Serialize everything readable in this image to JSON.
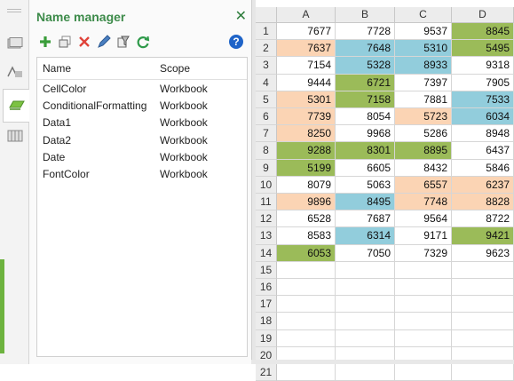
{
  "panel": {
    "title": "Name manager",
    "close_glyph": "✕",
    "toolbar": {
      "add_icon": "plus-icon",
      "edit_icon": "edit-icon",
      "delete_icon": "delete-icon",
      "pencil_icon": "pencil-icon",
      "filter_icon": "filter-icon",
      "refresh_icon": "refresh-icon",
      "help_glyph": "?"
    },
    "columns": [
      "Name",
      "Scope"
    ],
    "rows": [
      {
        "name": "CellColor",
        "scope": "Workbook"
      },
      {
        "name": "ConditionalFormatting",
        "scope": "Workbook"
      },
      {
        "name": "Data1",
        "scope": "Workbook"
      },
      {
        "name": "Data2",
        "scope": "Workbook"
      },
      {
        "name": "Date",
        "scope": "Workbook"
      },
      {
        "name": "FontColor",
        "scope": "Workbook"
      }
    ]
  },
  "colors": {
    "green": "#9bbb59",
    "blue": "#92cddc",
    "peach": "#fbd4b4",
    "white": "#ffffff",
    "accent": "#3d8b4a"
  },
  "sheet": {
    "columns": [
      "A",
      "B",
      "C",
      "D"
    ],
    "row_numbers": [
      "1",
      "2",
      "3",
      "4",
      "5",
      "6",
      "7",
      "8",
      "9",
      "10",
      "11",
      "12",
      "13",
      "14",
      "15",
      "16",
      "17",
      "18",
      "19",
      "20",
      "21"
    ],
    "cells": [
      [
        [
          "7677",
          "white"
        ],
        [
          "7728",
          "white"
        ],
        [
          "9537",
          "white"
        ],
        [
          "8845",
          "green"
        ]
      ],
      [
        [
          "7637",
          "peach"
        ],
        [
          "7648",
          "blue"
        ],
        [
          "5310",
          "blue"
        ],
        [
          "5495",
          "green"
        ]
      ],
      [
        [
          "7154",
          "white"
        ],
        [
          "5328",
          "blue"
        ],
        [
          "8933",
          "blue"
        ],
        [
          "9318",
          "white"
        ]
      ],
      [
        [
          "9444",
          "white"
        ],
        [
          "6721",
          "green"
        ],
        [
          "7397",
          "white"
        ],
        [
          "7905",
          "white"
        ]
      ],
      [
        [
          "5301",
          "peach"
        ],
        [
          "7158",
          "green"
        ],
        [
          "7881",
          "white"
        ],
        [
          "7533",
          "blue"
        ]
      ],
      [
        [
          "7739",
          "peach"
        ],
        [
          "8054",
          "white"
        ],
        [
          "5723",
          "peach"
        ],
        [
          "6034",
          "blue"
        ]
      ],
      [
        [
          "8250",
          "peach"
        ],
        [
          "9968",
          "white"
        ],
        [
          "5286",
          "white"
        ],
        [
          "8948",
          "white"
        ]
      ],
      [
        [
          "9288",
          "green"
        ],
        [
          "8301",
          "green"
        ],
        [
          "8895",
          "green"
        ],
        [
          "6437",
          "white"
        ]
      ],
      [
        [
          "5199",
          "green"
        ],
        [
          "6605",
          "white"
        ],
        [
          "8432",
          "white"
        ],
        [
          "5846",
          "white"
        ]
      ],
      [
        [
          "8079",
          "white"
        ],
        [
          "5063",
          "white"
        ],
        [
          "6557",
          "peach"
        ],
        [
          "6237",
          "peach"
        ]
      ],
      [
        [
          "9896",
          "peach"
        ],
        [
          "8495",
          "blue"
        ],
        [
          "7748",
          "peach"
        ],
        [
          "8828",
          "peach"
        ]
      ],
      [
        [
          "6528",
          "white"
        ],
        [
          "7687",
          "white"
        ],
        [
          "9564",
          "white"
        ],
        [
          "8722",
          "white"
        ]
      ],
      [
        [
          "8583",
          "white"
        ],
        [
          "6314",
          "blue"
        ],
        [
          "9171",
          "white"
        ],
        [
          "9421",
          "green"
        ]
      ],
      [
        [
          "6053",
          "green"
        ],
        [
          "7050",
          "white"
        ],
        [
          "7329",
          "white"
        ],
        [
          "9623",
          "white"
        ]
      ]
    ]
  }
}
